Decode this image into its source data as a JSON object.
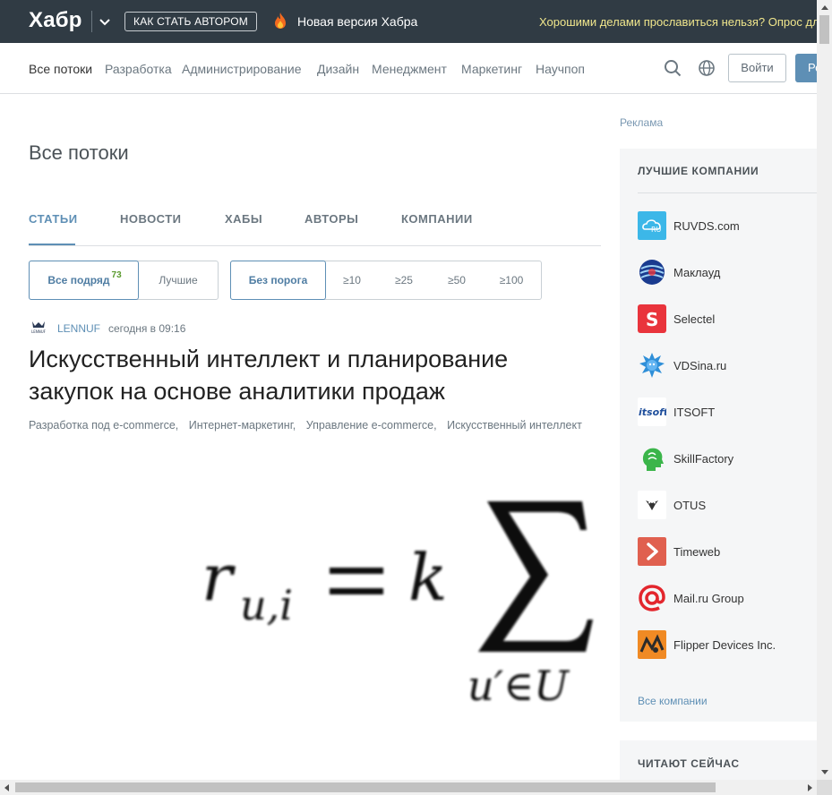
{
  "topbar": {
    "logo": "Хабр",
    "author_button": "КАК СТАТЬ АВТОРОМ",
    "new_version": "Новая версия Хабра",
    "promo": "Хорошими делами прославиться нельзя? Опрос для"
  },
  "nav": {
    "items": [
      "Все потоки",
      "Разработка",
      "Администрирование",
      "Дизайн",
      "Менеджмент",
      "Маркетинг",
      "Научпоп"
    ],
    "login": "Войти",
    "register": "Регистрация"
  },
  "page": {
    "title": "Все потоки",
    "tabs": [
      "СТАТЬИ",
      "НОВОСТИ",
      "ХАБЫ",
      "АВТОРЫ",
      "КОМПАНИИ"
    ],
    "filter1": {
      "all": "Все подряд",
      "count": "73",
      "best": "Лучшие"
    },
    "filter2": [
      "Без порога",
      "≥10",
      "≥25",
      "≥50",
      "≥100"
    ]
  },
  "article": {
    "author": "LENNUF",
    "time": "сегодня в 09:16",
    "title": "Искусственный интеллект и планирование закупок на основе аналитики продаж",
    "hubs": [
      "Разработка под e-commerce,",
      "Интернет-маркетинг,",
      "Управление e-commerce,",
      "Искусственный интеллект"
    ],
    "avatar_text": "LENNUF"
  },
  "sidebar": {
    "ad_label": "Реклама",
    "companies_header": "ЛУЧШИЕ КОМПАНИИ",
    "companies": [
      {
        "name": "RUVDS.com",
        "icon": "ruvds-logo",
        "color": "#3cb7e8"
      },
      {
        "name": "Маклауд",
        "icon": "maklaud-logo",
        "color": "#1a3b8f"
      },
      {
        "name": "Selectel",
        "icon": "selectel-logo",
        "color": "#e9343c"
      },
      {
        "name": "VDSina.ru",
        "icon": "vdsina-logo",
        "color": "#2f8fd8"
      },
      {
        "name": "ITSOFT",
        "icon": "itsoft-logo",
        "color": "#1f4f9c"
      },
      {
        "name": "SkillFactory",
        "icon": "skillfactory-logo",
        "color": "#3bb54a"
      },
      {
        "name": "OTUS",
        "icon": "otus-logo",
        "color": "#333333"
      },
      {
        "name": "Timeweb",
        "icon": "timeweb-logo",
        "color": "#e0604f"
      },
      {
        "name": "Mail.ru Group",
        "icon": "mailru-logo",
        "color": "#e3262d"
      },
      {
        "name": "Flipper Devices Inc.",
        "icon": "flipper-logo",
        "color": "#f08a24"
      }
    ],
    "all_companies": "Все компании",
    "reading_now": "ЧИТАЮТ СЕЙЧАС"
  },
  "colors": {
    "accent": "#5e8fb5",
    "topbar": "#303b44",
    "promo": "#f0e68c"
  }
}
